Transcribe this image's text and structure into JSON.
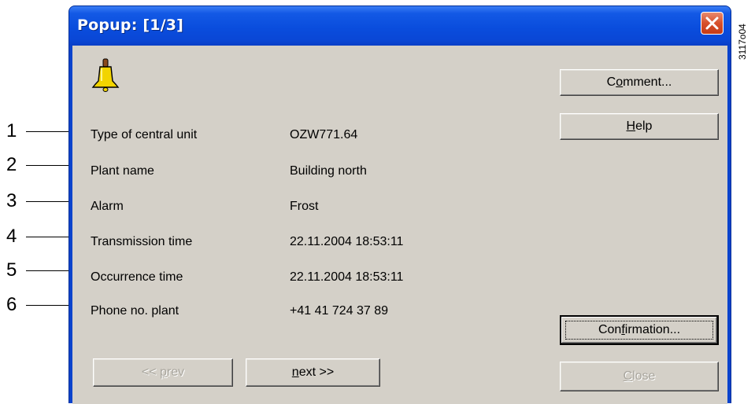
{
  "window": {
    "title": "Popup: [1/3]",
    "close_icon": "close-x-icon"
  },
  "alarm_icon": "bell-icon",
  "fields": [
    {
      "label": "Type of central unit",
      "value": "OZW771.64"
    },
    {
      "label": "Plant name",
      "value": "Building north"
    },
    {
      "label": "Alarm",
      "value": "Frost"
    },
    {
      "label": "Transmission time",
      "value": "22.11.2004 18:53:11"
    },
    {
      "label": "Occurrence time",
      "value": "22.11.2004 18:53:11"
    },
    {
      "label": "Phone no. plant",
      "value": "+41 41 724 37 89"
    }
  ],
  "buttons": {
    "comment": {
      "pre": "C",
      "mnemonic": "o",
      "post": "mment..."
    },
    "help": {
      "pre": "",
      "mnemonic": "H",
      "post": "elp"
    },
    "confirmation": {
      "pre": "Con",
      "mnemonic": "f",
      "post": "irmation..."
    },
    "close": {
      "pre": "",
      "mnemonic": "C",
      "post": "lose"
    },
    "prev": {
      "pre": "<< ",
      "mnemonic": "p",
      "post": "rev"
    },
    "next": {
      "pre": "",
      "mnemonic": "n",
      "post": "ext >>"
    }
  },
  "callouts": [
    "1",
    "2",
    "3",
    "4",
    "5",
    "6"
  ],
  "document_id": "3117o04"
}
